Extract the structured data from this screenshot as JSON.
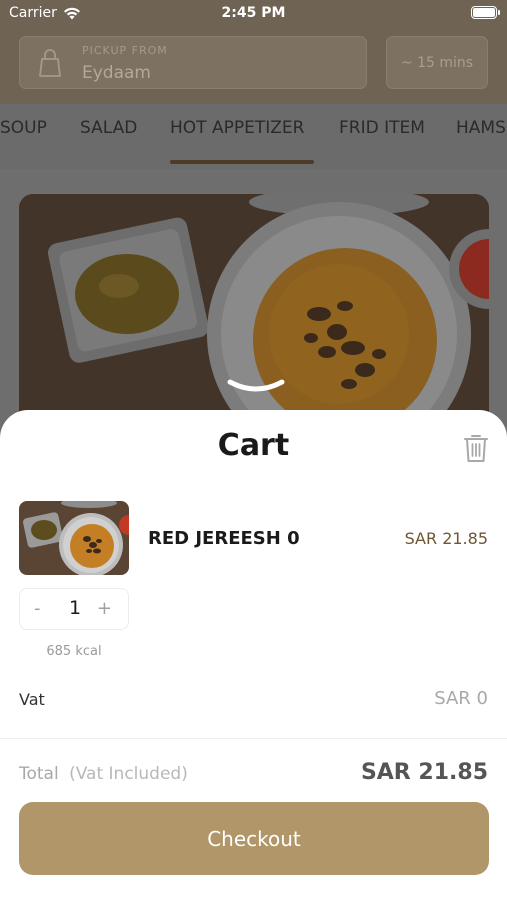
{
  "status_bar": {
    "carrier": "Carrier",
    "time": "2:45 PM"
  },
  "header": {
    "pickup_label": "PICKUP FROM",
    "pickup_value": "Eydaam",
    "eta": "~ 15 mins"
  },
  "categories": [
    "SOUP",
    "SALAD",
    "HOT APPETIZER",
    "FRID ITEM",
    "HAMS"
  ],
  "active_category": "HOT APPETIZER",
  "cart": {
    "title": "Cart",
    "item": {
      "name": "RED JEREESH 0",
      "price": "SAR 21.85",
      "quantity": "1",
      "minus": "-",
      "plus": "+",
      "kcal": "685 kcal"
    },
    "vat_label": "Vat",
    "vat_value": "SAR 0",
    "total_label": "Total",
    "total_note": "(Vat Included)",
    "total_value": "SAR 21.85",
    "checkout_label": "Checkout"
  },
  "colors": {
    "brand": "#b09669",
    "price": "#6e5634",
    "header_band": "#6f6354"
  },
  "icons": [
    "wifi-icon",
    "battery-icon",
    "shopping-bag-icon",
    "chevron-down-icon",
    "trash-icon"
  ]
}
